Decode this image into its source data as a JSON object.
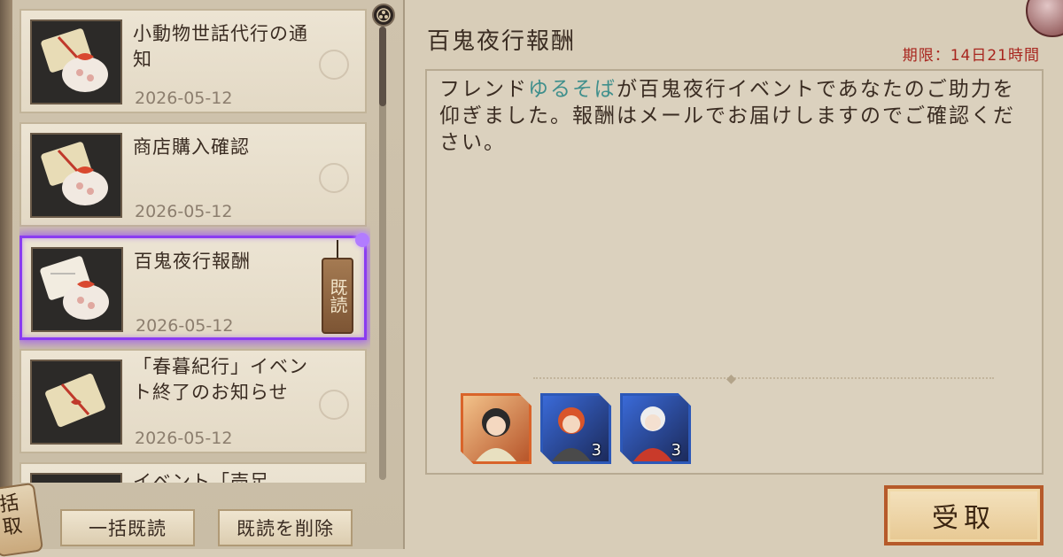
{
  "mail_list": {
    "items": [
      {
        "title": "小動物世話代行の通知",
        "date": "2026-05-12",
        "icon": "gift-package-icon",
        "read": false
      },
      {
        "title": "商店購入確認",
        "date": "2026-05-12",
        "icon": "gift-package-icon",
        "read": false
      },
      {
        "title": "百鬼夜行報酬",
        "date": "2026-05-12",
        "icon": "gift-package-letter-icon",
        "read": true,
        "selected": true
      },
      {
        "title": "「春暮紀行」イベント終了のお知らせ",
        "date": "2026-05-12",
        "icon": "letter-icon",
        "read": false
      },
      {
        "title": "イベント「売足",
        "date": "",
        "icon": "gift-package-icon",
        "read": false
      }
    ],
    "read_tag": "既読"
  },
  "buttons": {
    "read_all": "一括既読",
    "delete_read": "既読を削除",
    "receive": "受取"
  },
  "side_tab_label": "括\n取",
  "detail": {
    "title": "百鬼夜行報酬",
    "deadline": "期限：14日21時間",
    "body_prefix": "フレンド",
    "body_highlight": "ゆるそば",
    "body_suffix": "が百鬼夜行イベントであなたのご助力を仰ぎました。報酬はメールでお届けしますのでご確認ください。",
    "rewards": [
      {
        "icon": "shikigami-portrait-icon",
        "count": ""
      },
      {
        "icon": "shikigami-portrait-icon",
        "count": "3"
      },
      {
        "icon": "shikigami-portrait-icon",
        "count": "3"
      }
    ]
  },
  "colors": {
    "selected_border": "#8a3cf0",
    "deadline_red": "#a8251e",
    "highlight_teal": "#3f8f8c"
  }
}
